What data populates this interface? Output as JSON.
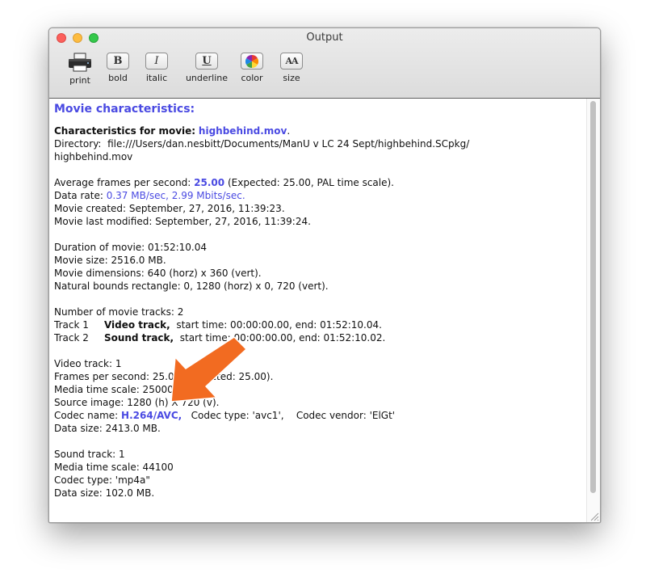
{
  "window": {
    "title": "Output"
  },
  "toolbar": [
    {
      "label": "print",
      "icon": "printer-icon"
    },
    {
      "label": "bold",
      "glyph": "B",
      "icon": "bold-icon"
    },
    {
      "label": "italic",
      "glyph": "I",
      "icon": "italic-icon"
    },
    {
      "label": "underline",
      "glyph": "U",
      "icon": "underline-icon"
    },
    {
      "label": "color",
      "icon": "color-wheel-icon"
    },
    {
      "label": "size",
      "glyph": "AA",
      "icon": "font-size-icon"
    }
  ],
  "content": {
    "heading": "Movie characteristics:",
    "block1": {
      "char_label": "Characteristics for movie:",
      "movie_name": "highbehind.mov",
      "period": ".",
      "dir_label": "Directory:",
      "dir_path1": "file:///Users/dan.nesbitt/Documents/ManU v LC 24 Sept/highbehind.SCpkg/",
      "dir_path2": "highbehind.mov"
    },
    "block2": {
      "fps_label": "Average frames per second:",
      "fps_value": "25.00",
      "fps_rest": "(Expected: 25.00, PAL time scale).",
      "rate_label": "Data rate:",
      "rate_value": "0.37 MB/sec,  2.99 Mbits/sec.",
      "created": "Movie created: September, 27, 2016,   11:39:23.",
      "modified": "Movie last modified: September, 27, 2016,   11:39:24."
    },
    "block3": {
      "duration": "Duration of movie:  01:52:10.04",
      "size": "Movie size: 2516.0 MB.",
      "dimensions": "Movie dimensions: 640 (horz)  x 360 (vert).",
      "bounds": "Natural bounds rectangle: 0, 1280 (horz) x 0, 720 (vert)."
    },
    "block4": {
      "num_tracks": "Number of movie tracks: 2",
      "tracks": [
        {
          "id": "Track 1",
          "type": "Video track,",
          "times": "start time: 00:00:00.00,  end:  01:52:10.04."
        },
        {
          "id": "Track 2",
          "type": "Sound track,",
          "times": "start time: 00:00:00.00,  end:  01:52:10.02."
        }
      ]
    },
    "block5": {
      "video_track": "Video track: 1",
      "fps": "Frames per second: 25.00 (Expected: 25.00).",
      "time_scale": "Media time scale: 25000",
      "source": "Source image: 1280 (h)  X  720 (v).",
      "codec_label": "Codec name:",
      "codec_value": "H.264/AVC,",
      "codec_rest": "   Codec type: 'avc1',    Codec vendor: 'ElGt'",
      "data_size": "Data size: 2413.0 MB."
    },
    "block6": {
      "sound_track": "Sound track: 1",
      "time_scale": "Media time scale: 44100",
      "codec_type": "Codec type: 'mp4a\"",
      "data_size": "Data size: 102.0 MB."
    }
  },
  "colors": {
    "highlight_text": "#4a4ae2",
    "annotation_arrow": "#f26b21"
  }
}
